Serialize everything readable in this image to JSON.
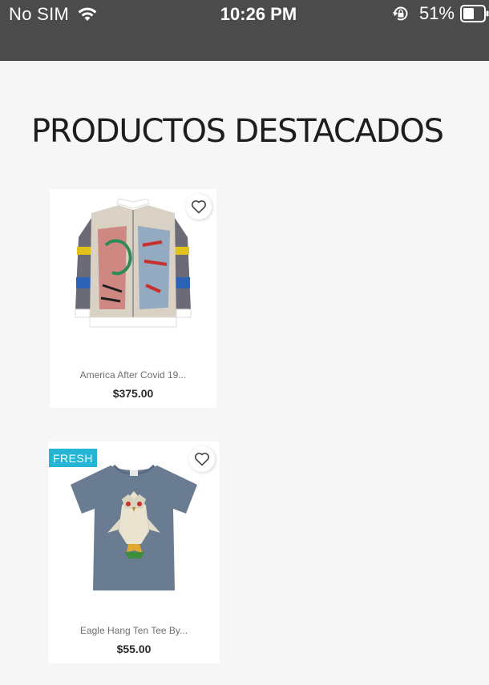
{
  "status_bar": {
    "carrier": "No SIM",
    "time": "10:26 PM",
    "battery_percent": "51%",
    "icons": [
      "wifi-icon",
      "orientation-lock-icon",
      "battery-icon"
    ]
  },
  "section": {
    "title": "PRODUCTOS DESTACADOS"
  },
  "products": [
    {
      "name": "America After Covid 19...",
      "price": "$375.00",
      "badge": "",
      "image": "jacket-image",
      "wishlist_icon": "heart-icon"
    },
    {
      "name": "Eagle Hang Ten Tee By...",
      "price": "$55.00",
      "badge": "FRESH",
      "image": "tshirt-image",
      "wishlist_icon": "heart-icon"
    }
  ],
  "colors": {
    "status_bar_bg": "#4b4b4b",
    "page_bg": "#f6f6f6",
    "badge_bg": "#23b5d3",
    "title_text": "#1d1d1d"
  }
}
